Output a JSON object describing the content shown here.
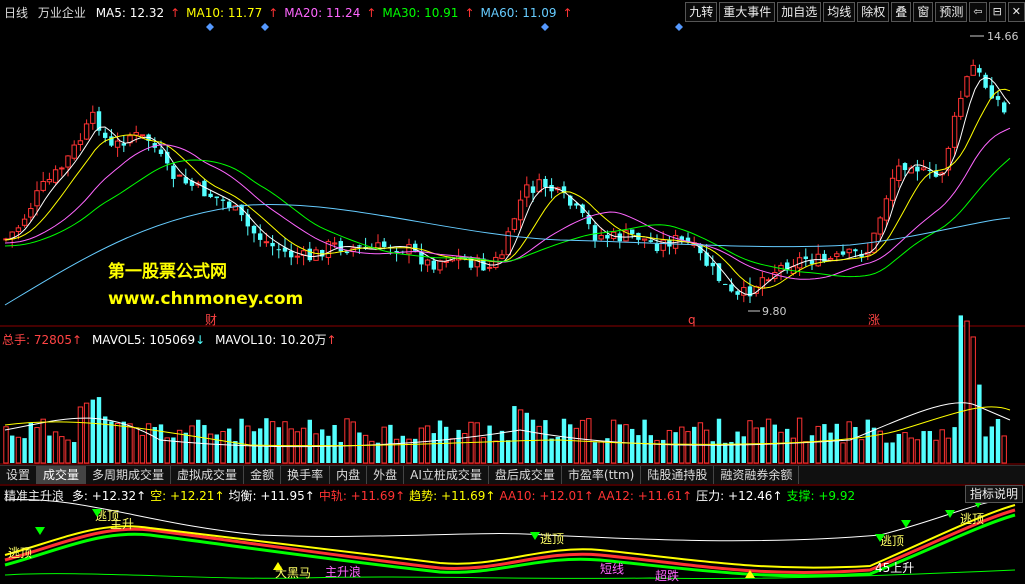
{
  "header": {
    "chart_type": "日线",
    "stock_name": "万业企业",
    "ma_items": [
      {
        "label": "MA5: 12.32",
        "arrow": "↑",
        "color": "#ffffff"
      },
      {
        "label": "MA10: 11.77",
        "arrow": "↑",
        "color": "#ffff00"
      },
      {
        "label": "MA20: 11.24",
        "arrow": "↑",
        "color": "#ff66ff"
      },
      {
        "label": "MA30: 10.91",
        "arrow": "↑",
        "color": "#00ff00"
      },
      {
        "label": "MA60: 11.09",
        "arrow": "↑",
        "color": "#66ccff"
      }
    ],
    "buttons": [
      "九转",
      "重大事件",
      "加自选",
      "均线",
      "除权",
      "叠",
      "窗",
      "预测"
    ],
    "icon_buttons": [
      "back-icon",
      "lock-icon",
      "close-icon"
    ]
  },
  "price_chart": {
    "high_label": "14.66",
    "low_label": "9.80",
    "event_markers": [
      "财",
      "q",
      "涨"
    ],
    "watermark_line1": "第一股票公式网",
    "watermark_line2": "www.chnmoney.com",
    "colors": {
      "up": "#ff3333",
      "down": "#54ffff",
      "ma5": "#ffffff",
      "ma10": "#ffff00",
      "ma20": "#ff66ff",
      "ma30": "#00ff00",
      "ma60": "#66ccff"
    }
  },
  "volume_panel": {
    "total_label": "总手: 72805",
    "total_arrow": "↑",
    "mavol5_label": "MAVOL5: 105069",
    "mavol5_arrow": "↓",
    "mavol10_label": "MAVOL10: 10.20万",
    "mavol10_arrow": "↑"
  },
  "tabs": [
    "设置",
    "成交量",
    "多周期成交量",
    "虚拟成交量",
    "金额",
    "换手率",
    "内盘",
    "外盘",
    "AI立桩成交量",
    "盘后成交量",
    "市盈率(ttm)",
    "陆股通持股",
    "融资融券余额"
  ],
  "active_tab": 1,
  "indicator": {
    "name": "精准主升浪",
    "items": [
      {
        "label": "多: +12.32",
        "arrow": "↑",
        "color": "#ffffff"
      },
      {
        "label": "空: +12.21",
        "arrow": "↑",
        "color": "#ffff00"
      },
      {
        "label": "均衡: +11.95",
        "arrow": "↑",
        "color": "#ffffff"
      },
      {
        "label": "中轨: +11.69",
        "arrow": "↑",
        "color": "#ff3333"
      },
      {
        "label": "趋势: +11.69",
        "arrow": "↑",
        "color": "#ffff00"
      },
      {
        "label": "AA10: +12.01",
        "arrow": "↑",
        "color": "#ff3333"
      },
      {
        "label": "AA12: +11.61",
        "arrow": "↑",
        "color": "#ff3333"
      },
      {
        "label": "压力: +12.46",
        "arrow": "↑",
        "color": "#ffffff"
      },
      {
        "label": "支撑: +9.92",
        "arrow": "",
        "color": "#00ff00"
      }
    ],
    "help_button": "指标说明",
    "labels": [
      "逃顶",
      "主升",
      "大黑马",
      "主升浪",
      "短线",
      "超跌",
      "45上升",
      "买",
      "卖"
    ]
  }
}
